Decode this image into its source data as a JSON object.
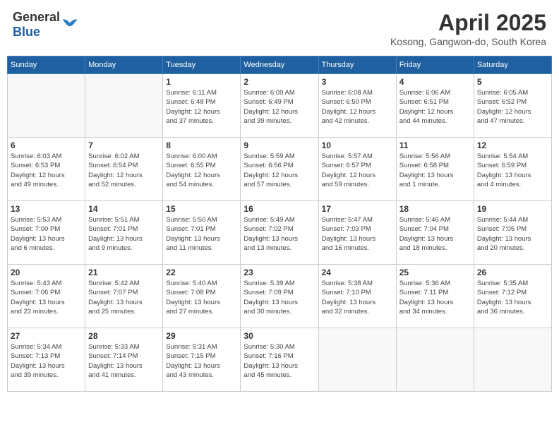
{
  "header": {
    "logo_general": "General",
    "logo_blue": "Blue",
    "month_title": "April 2025",
    "location": "Kosong, Gangwon-do, South Korea"
  },
  "weekdays": [
    "Sunday",
    "Monday",
    "Tuesday",
    "Wednesday",
    "Thursday",
    "Friday",
    "Saturday"
  ],
  "weeks": [
    [
      {
        "day": "",
        "info": ""
      },
      {
        "day": "",
        "info": ""
      },
      {
        "day": "1",
        "info": "Sunrise: 6:11 AM\nSunset: 6:48 PM\nDaylight: 12 hours\nand 37 minutes."
      },
      {
        "day": "2",
        "info": "Sunrise: 6:09 AM\nSunset: 6:49 PM\nDaylight: 12 hours\nand 39 minutes."
      },
      {
        "day": "3",
        "info": "Sunrise: 6:08 AM\nSunset: 6:50 PM\nDaylight: 12 hours\nand 42 minutes."
      },
      {
        "day": "4",
        "info": "Sunrise: 6:06 AM\nSunset: 6:51 PM\nDaylight: 12 hours\nand 44 minutes."
      },
      {
        "day": "5",
        "info": "Sunrise: 6:05 AM\nSunset: 6:52 PM\nDaylight: 12 hours\nand 47 minutes."
      }
    ],
    [
      {
        "day": "6",
        "info": "Sunrise: 6:03 AM\nSunset: 6:53 PM\nDaylight: 12 hours\nand 49 minutes."
      },
      {
        "day": "7",
        "info": "Sunrise: 6:02 AM\nSunset: 6:54 PM\nDaylight: 12 hours\nand 52 minutes."
      },
      {
        "day": "8",
        "info": "Sunrise: 6:00 AM\nSunset: 6:55 PM\nDaylight: 12 hours\nand 54 minutes."
      },
      {
        "day": "9",
        "info": "Sunrise: 5:59 AM\nSunset: 6:56 PM\nDaylight: 12 hours\nand 57 minutes."
      },
      {
        "day": "10",
        "info": "Sunrise: 5:57 AM\nSunset: 6:57 PM\nDaylight: 12 hours\nand 59 minutes."
      },
      {
        "day": "11",
        "info": "Sunrise: 5:56 AM\nSunset: 6:58 PM\nDaylight: 13 hours\nand 1 minute."
      },
      {
        "day": "12",
        "info": "Sunrise: 5:54 AM\nSunset: 6:59 PM\nDaylight: 13 hours\nand 4 minutes."
      }
    ],
    [
      {
        "day": "13",
        "info": "Sunrise: 5:53 AM\nSunset: 7:00 PM\nDaylight: 13 hours\nand 6 minutes."
      },
      {
        "day": "14",
        "info": "Sunrise: 5:51 AM\nSunset: 7:01 PM\nDaylight: 13 hours\nand 9 minutes."
      },
      {
        "day": "15",
        "info": "Sunrise: 5:50 AM\nSunset: 7:01 PM\nDaylight: 13 hours\nand 11 minutes."
      },
      {
        "day": "16",
        "info": "Sunrise: 5:49 AM\nSunset: 7:02 PM\nDaylight: 13 hours\nand 13 minutes."
      },
      {
        "day": "17",
        "info": "Sunrise: 5:47 AM\nSunset: 7:03 PM\nDaylight: 13 hours\nand 16 minutes."
      },
      {
        "day": "18",
        "info": "Sunrise: 5:46 AM\nSunset: 7:04 PM\nDaylight: 13 hours\nand 18 minutes."
      },
      {
        "day": "19",
        "info": "Sunrise: 5:44 AM\nSunset: 7:05 PM\nDaylight: 13 hours\nand 20 minutes."
      }
    ],
    [
      {
        "day": "20",
        "info": "Sunrise: 5:43 AM\nSunset: 7:06 PM\nDaylight: 13 hours\nand 23 minutes."
      },
      {
        "day": "21",
        "info": "Sunrise: 5:42 AM\nSunset: 7:07 PM\nDaylight: 13 hours\nand 25 minutes."
      },
      {
        "day": "22",
        "info": "Sunrise: 5:40 AM\nSunset: 7:08 PM\nDaylight: 13 hours\nand 27 minutes."
      },
      {
        "day": "23",
        "info": "Sunrise: 5:39 AM\nSunset: 7:09 PM\nDaylight: 13 hours\nand 30 minutes."
      },
      {
        "day": "24",
        "info": "Sunrise: 5:38 AM\nSunset: 7:10 PM\nDaylight: 13 hours\nand 32 minutes."
      },
      {
        "day": "25",
        "info": "Sunrise: 5:36 AM\nSunset: 7:11 PM\nDaylight: 13 hours\nand 34 minutes."
      },
      {
        "day": "26",
        "info": "Sunrise: 5:35 AM\nSunset: 7:12 PM\nDaylight: 13 hours\nand 36 minutes."
      }
    ],
    [
      {
        "day": "27",
        "info": "Sunrise: 5:34 AM\nSunset: 7:13 PM\nDaylight: 13 hours\nand 39 minutes."
      },
      {
        "day": "28",
        "info": "Sunrise: 5:33 AM\nSunset: 7:14 PM\nDaylight: 13 hours\nand 41 minutes."
      },
      {
        "day": "29",
        "info": "Sunrise: 5:31 AM\nSunset: 7:15 PM\nDaylight: 13 hours\nand 43 minutes."
      },
      {
        "day": "30",
        "info": "Sunrise: 5:30 AM\nSunset: 7:16 PM\nDaylight: 13 hours\nand 45 minutes."
      },
      {
        "day": "",
        "info": ""
      },
      {
        "day": "",
        "info": ""
      },
      {
        "day": "",
        "info": ""
      }
    ]
  ]
}
